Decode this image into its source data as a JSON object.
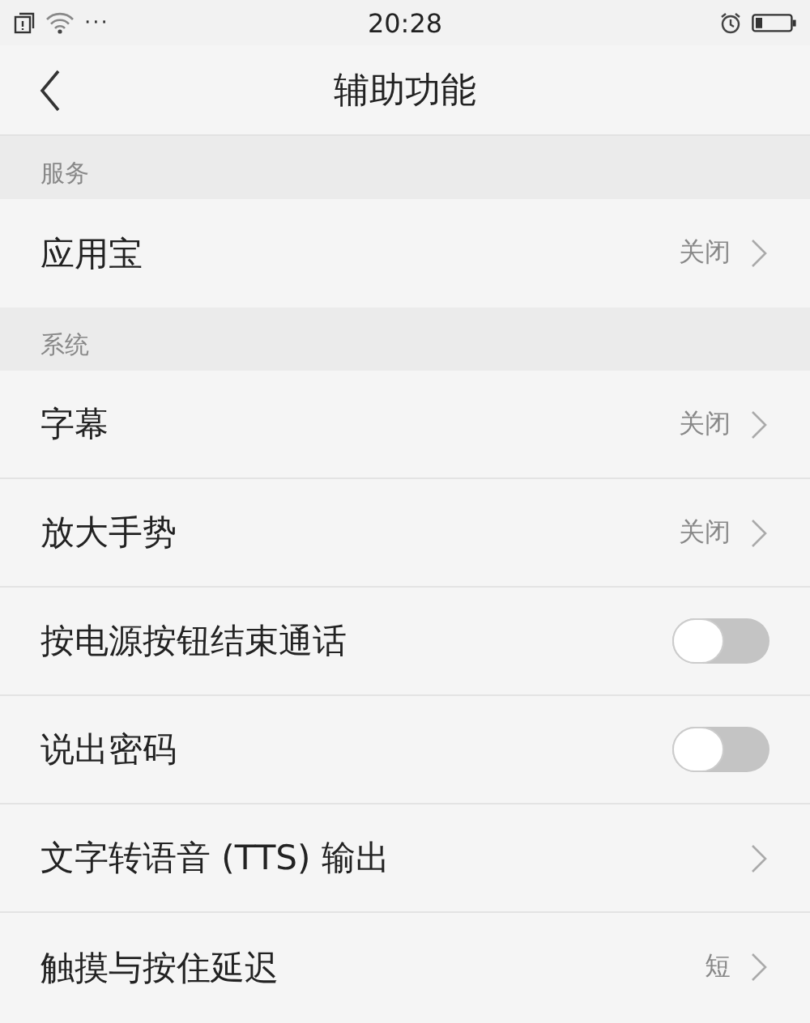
{
  "status_bar": {
    "time": "20:28",
    "more": "···"
  },
  "nav": {
    "title": "辅助功能"
  },
  "sections": [
    {
      "header": "服务",
      "rows": [
        {
          "kind": "link",
          "label": "应用宝",
          "value": "关闭"
        }
      ]
    },
    {
      "header": "系统",
      "rows": [
        {
          "kind": "link",
          "label": "字幕",
          "value": "关闭"
        },
        {
          "kind": "link",
          "label": "放大手势",
          "value": "关闭"
        },
        {
          "kind": "toggle",
          "label": "按电源按钮结束通话",
          "on": false
        },
        {
          "kind": "toggle",
          "label": "说出密码",
          "on": false
        },
        {
          "kind": "link",
          "label": "文字转语音 (TTS) 输出"
        },
        {
          "kind": "link",
          "label": "触摸与按住延迟",
          "value": "短"
        }
      ]
    }
  ]
}
